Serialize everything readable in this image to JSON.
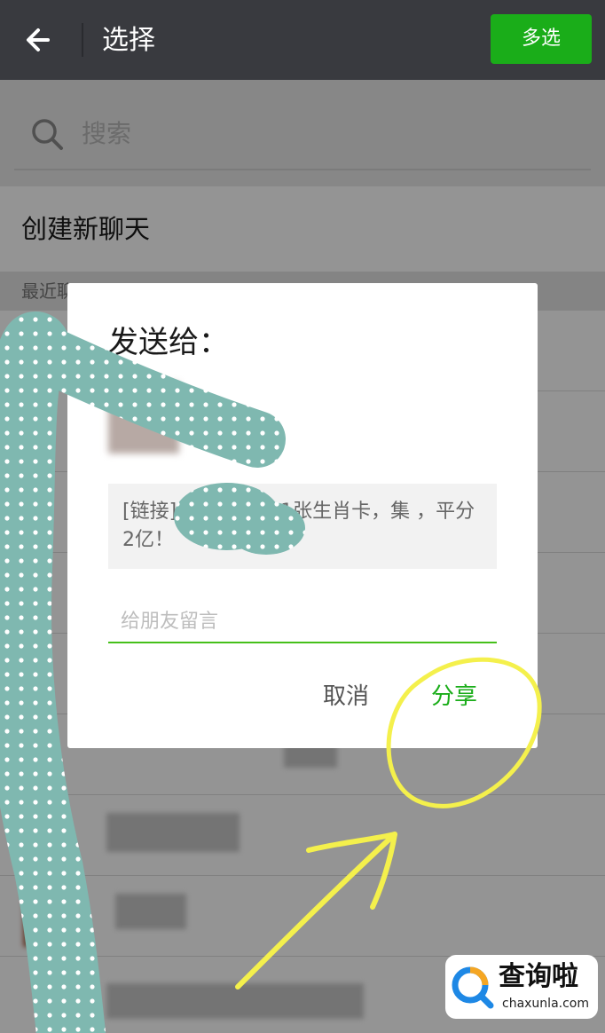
{
  "header": {
    "title": "选择",
    "multi_select_label": "多选",
    "back_icon": "arrow-left-icon"
  },
  "search": {
    "placeholder": "搜索",
    "icon": "search-icon"
  },
  "new_chat_label": "创建新聊天",
  "recent_section_label": "最近聊天",
  "dialog": {
    "title": "发送给：",
    "link_preview": "[链接]        不相知送你1张生肖卡，集      ，平分2亿！",
    "message_placeholder": "给朋友留言",
    "cancel_label": "取消",
    "share_label": "分享"
  },
  "watermark": {
    "name": "查询啦",
    "url": "chaxunla.com"
  },
  "colors": {
    "topbar": "#393a3f",
    "accent_green": "#1aad19",
    "annotation_yellow": "#f4f04c",
    "scribble_teal": "#7fb8b0"
  }
}
